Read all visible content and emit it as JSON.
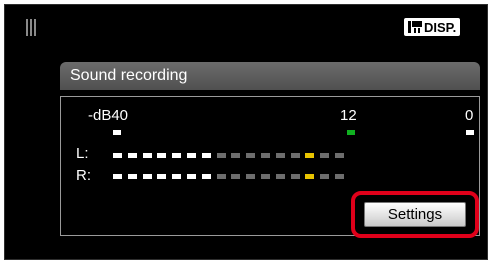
{
  "header": {
    "mode_icon": "bars-icon",
    "disp_badge": {
      "icon": "movie-camera-icon",
      "label": "DISP."
    }
  },
  "panel": {
    "title": "Sound recording",
    "scale": {
      "db_label": "-dB40",
      "mid_label": "12",
      "zero_label": "0"
    },
    "channels": [
      {
        "label": "L:",
        "lit_segments": 7,
        "peak_segment": 13
      },
      {
        "label": "R:",
        "lit_segments": 7,
        "peak_segment": 13
      }
    ],
    "meter": {
      "total_segments": 16
    },
    "settings_button": "Settings"
  },
  "colors": {
    "lit": "#ffffff",
    "unlit": "#6d6d6d",
    "peak": "#e8c400",
    "marker_12": "#10b020",
    "highlight": "#e0001a"
  }
}
